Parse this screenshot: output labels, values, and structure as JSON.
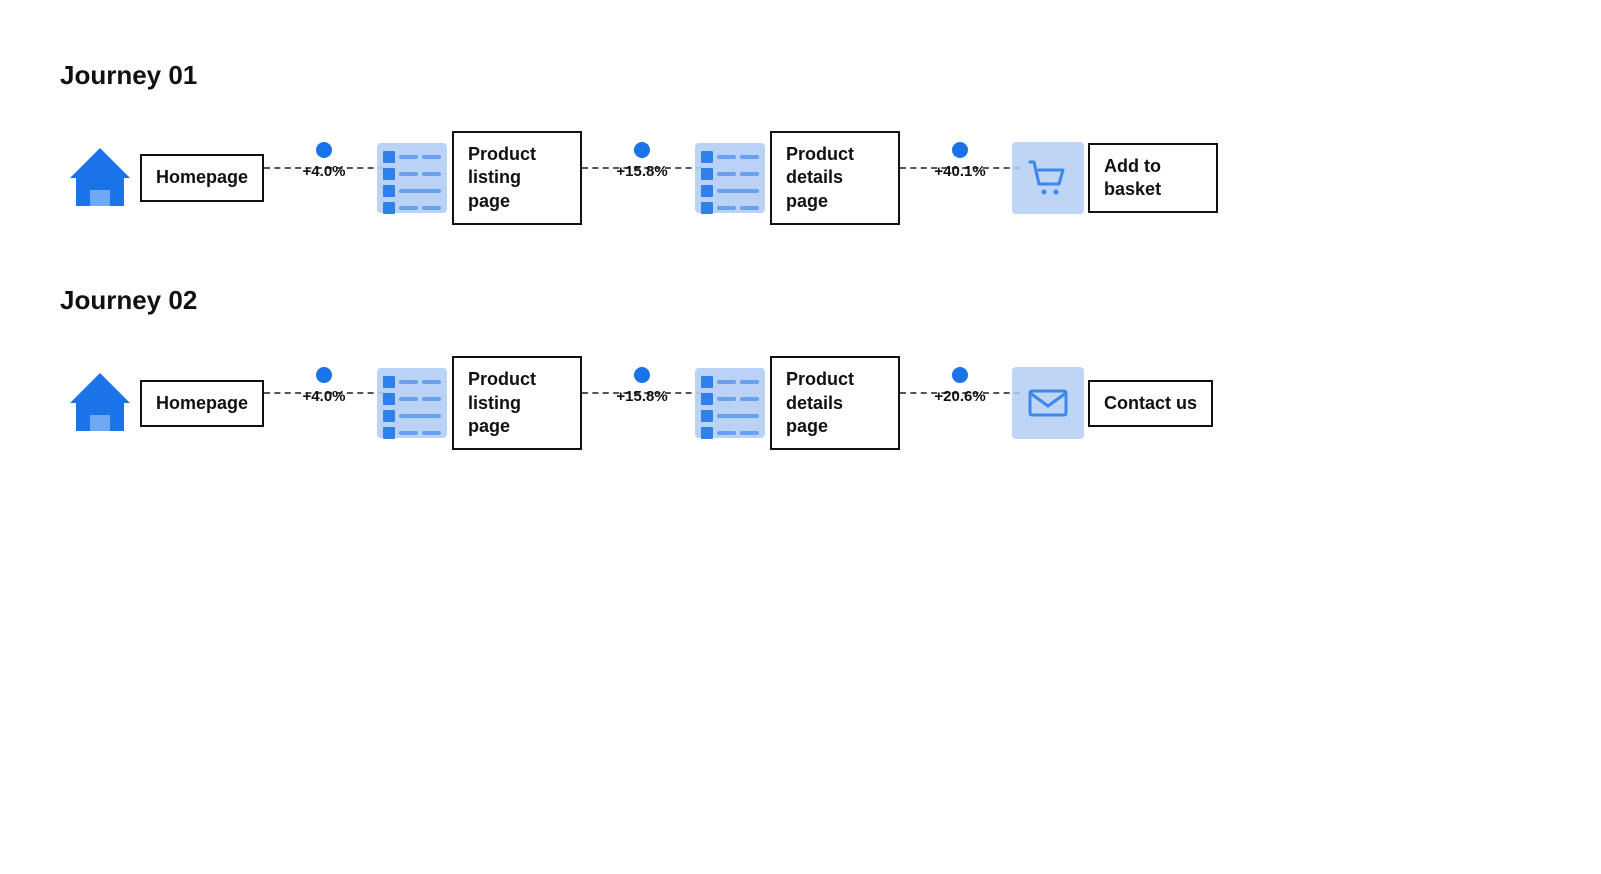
{
  "journeys": [
    {
      "id": "journey-01",
      "title": "Journey 01",
      "steps": [
        {
          "id": "homepage",
          "label": "Homepage",
          "icon": "house"
        },
        {
          "connector": "+4.0%"
        },
        {
          "id": "product-listing",
          "label": "Product listing page",
          "icon": "list"
        },
        {
          "connector": "+15.8%"
        },
        {
          "id": "product-details-1",
          "label": "Product details page",
          "icon": "list"
        },
        {
          "connector": "+40.1%"
        },
        {
          "id": "add-to-basket",
          "label": "Add to basket",
          "icon": "cart"
        }
      ]
    },
    {
      "id": "journey-02",
      "title": "Journey 02",
      "steps": [
        {
          "id": "homepage2",
          "label": "Homepage",
          "icon": "house"
        },
        {
          "connector": "+4.0%"
        },
        {
          "id": "product-listing2",
          "label": "Product listing page",
          "icon": "list"
        },
        {
          "connector": "+15.8%"
        },
        {
          "id": "product-details-2",
          "label": "Product details page",
          "icon": "list"
        },
        {
          "connector": "+20.6%"
        },
        {
          "id": "contact-us",
          "label": "Contact us",
          "icon": "envelope"
        }
      ]
    }
  ]
}
